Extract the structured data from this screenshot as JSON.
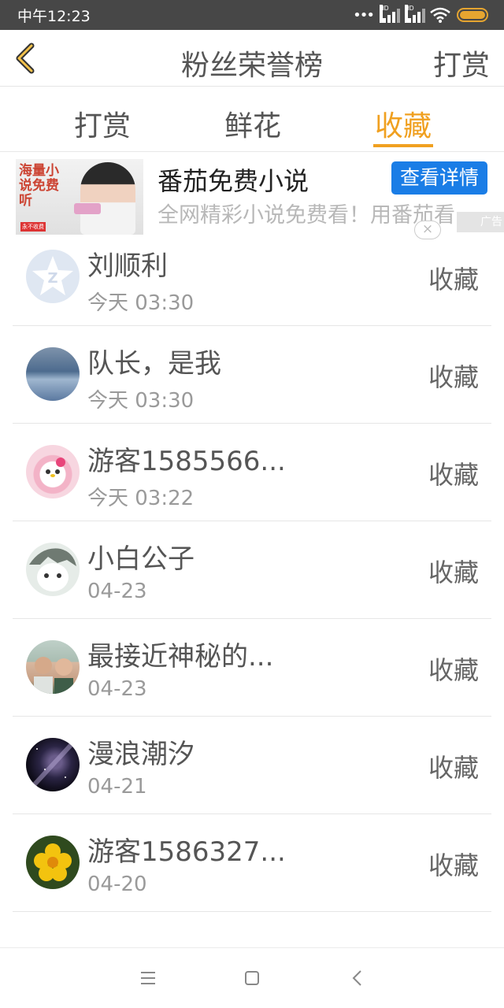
{
  "status_bar": {
    "time": "中午12:23",
    "sim1_label": "HD",
    "sim2_label": "HD",
    "battery_color": "#e6a530"
  },
  "header": {
    "title": "粉丝荣誉榜",
    "right_action": "打赏",
    "back_icon": "chevron-left-icon"
  },
  "tabs": [
    {
      "label": "打赏",
      "active": false
    },
    {
      "label": "鲜花",
      "active": false
    },
    {
      "label": "收藏",
      "active": true
    }
  ],
  "accent_color": "#f0a020",
  "ad": {
    "image_text": "海量小说免费听",
    "image_badge": "永不收费",
    "title": "番茄免费小说",
    "description": "全网精彩小说免费看！用番茄看",
    "button_label": "查看详情",
    "tag": "广告",
    "close_symbol": "×"
  },
  "fans": [
    {
      "name": "刘顺利",
      "date": "今天 03:30",
      "action": "收藏",
      "avatar": "qq-default-avatar"
    },
    {
      "name": "队长，是我",
      "date": "今天 03:30",
      "action": "收藏",
      "avatar": "snow-landscape-avatar"
    },
    {
      "name": "游客1585566...",
      "date": "今天 03:22",
      "action": "收藏",
      "avatar": "hello-kitty-avatar"
    },
    {
      "name": "小白公子",
      "date": "04-23",
      "action": "收藏",
      "avatar": "cartoon-boy-avatar"
    },
    {
      "name": "最接近神秘的...",
      "date": "04-23",
      "action": "收藏",
      "avatar": "couple-photo-avatar"
    },
    {
      "name": "漫浪潮汐",
      "date": "04-21",
      "action": "收藏",
      "avatar": "galaxy-avatar"
    },
    {
      "name": "游客1586327...",
      "date": "04-20",
      "action": "收藏",
      "avatar": "yellow-flower-avatar"
    }
  ],
  "nav": {
    "menu_icon": "menu-icon",
    "home_icon": "home-square-icon",
    "back_icon": "back-triangle-icon"
  }
}
